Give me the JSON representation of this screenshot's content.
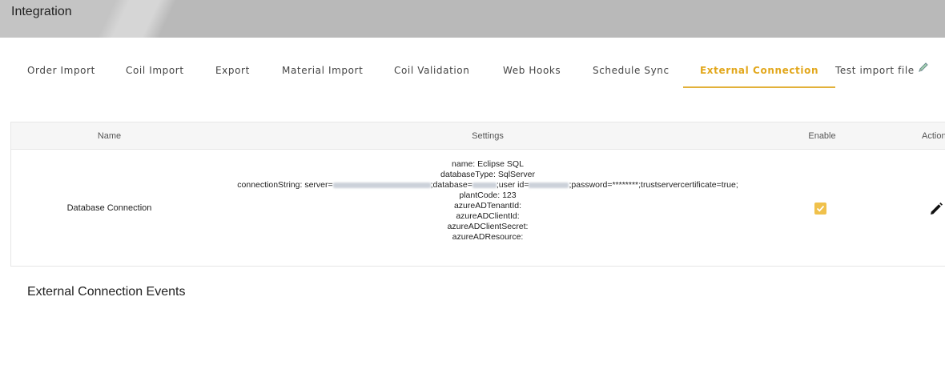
{
  "header": {
    "title": "Integration"
  },
  "tabs": [
    {
      "label": "Order Import",
      "active": false
    },
    {
      "label": "Coil Import",
      "active": false
    },
    {
      "label": "Export",
      "active": false
    },
    {
      "label": "Material Import",
      "active": false
    },
    {
      "label": "Coil Validation",
      "active": false
    },
    {
      "label": "Web Hooks",
      "active": false
    },
    {
      "label": "Schedule Sync",
      "active": false
    },
    {
      "label": "External Connection",
      "active": true
    },
    {
      "label": "Test import file",
      "active": false,
      "icon": "pencil-icon"
    }
  ],
  "table": {
    "columns": {
      "name": "Name",
      "settings": "Settings",
      "enable": "Enable",
      "action": "Action"
    },
    "rows": [
      {
        "name": "Database Connection",
        "settings": {
          "name": "name: Eclipse SQL",
          "databaseType": "databaseType: SqlServer",
          "connection_prefix": "connectionString: server=",
          "connection_db": ";database=",
          "connection_user": ";user id=",
          "connection_rest": ";password=********;trustservercertificate=true;",
          "plantCode": "plantCode: 123",
          "azureADTenantId": "azureADTenantId:",
          "azureADClientId": "azureADClientId:",
          "azureADClientSecret": "azureADClientSecret:",
          "azureADResource": "azureADResource:"
        },
        "enabled": true
      }
    ]
  },
  "events": {
    "title": "External Connection Events"
  },
  "colors": {
    "accent": "#e2a71c",
    "checkbox": "#f0c14b",
    "header_bg": "#b9b9b9"
  }
}
